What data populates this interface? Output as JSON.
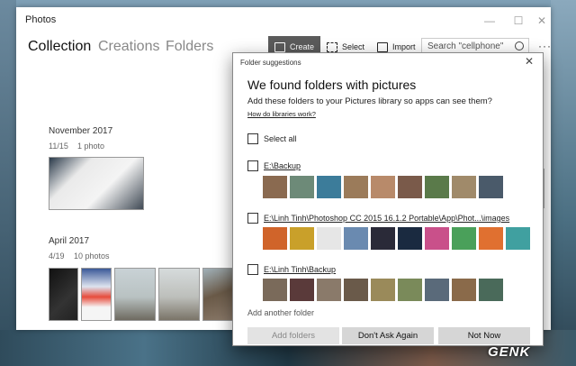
{
  "window": {
    "title": "Photos",
    "minimize": "—",
    "maximize": "☐",
    "close": "✕"
  },
  "nav": {
    "tabs": [
      "Collection",
      "Creations",
      "Folders"
    ]
  },
  "toolbar": {
    "create": "Create",
    "select": "Select",
    "import": "Import",
    "more": "···"
  },
  "search": {
    "placeholder": "Search \"cellphone\""
  },
  "groups": [
    {
      "title": "November 2017",
      "date": "11/15",
      "count": "1 photo"
    },
    {
      "title": "April 2017",
      "date": "4/19",
      "count": "10 photos"
    }
  ],
  "dialog": {
    "title": "Folder suggestions",
    "close": "✕",
    "heading": "We found folders with pictures",
    "description": "Add these folders to your Pictures library so apps can see them?",
    "link": "How do libraries work?",
    "select_all": "Select all",
    "folders": [
      "E:\\Backup",
      "E:\\Linh Tinh\\Photoshop CC 2015 16.1.2 Portable\\App\\Phot...\\images",
      "E:\\Linh Tinh\\Backup"
    ],
    "add_another": "Add another folder",
    "buttons": {
      "add": "Add folders",
      "dont_ask": "Don't Ask Again",
      "not_now": "Not Now"
    }
  },
  "watermark": "GENK",
  "colors": {
    "create_button_bg": "#5b5b5b",
    "dialog_button_bg": "#d6d6d6"
  }
}
